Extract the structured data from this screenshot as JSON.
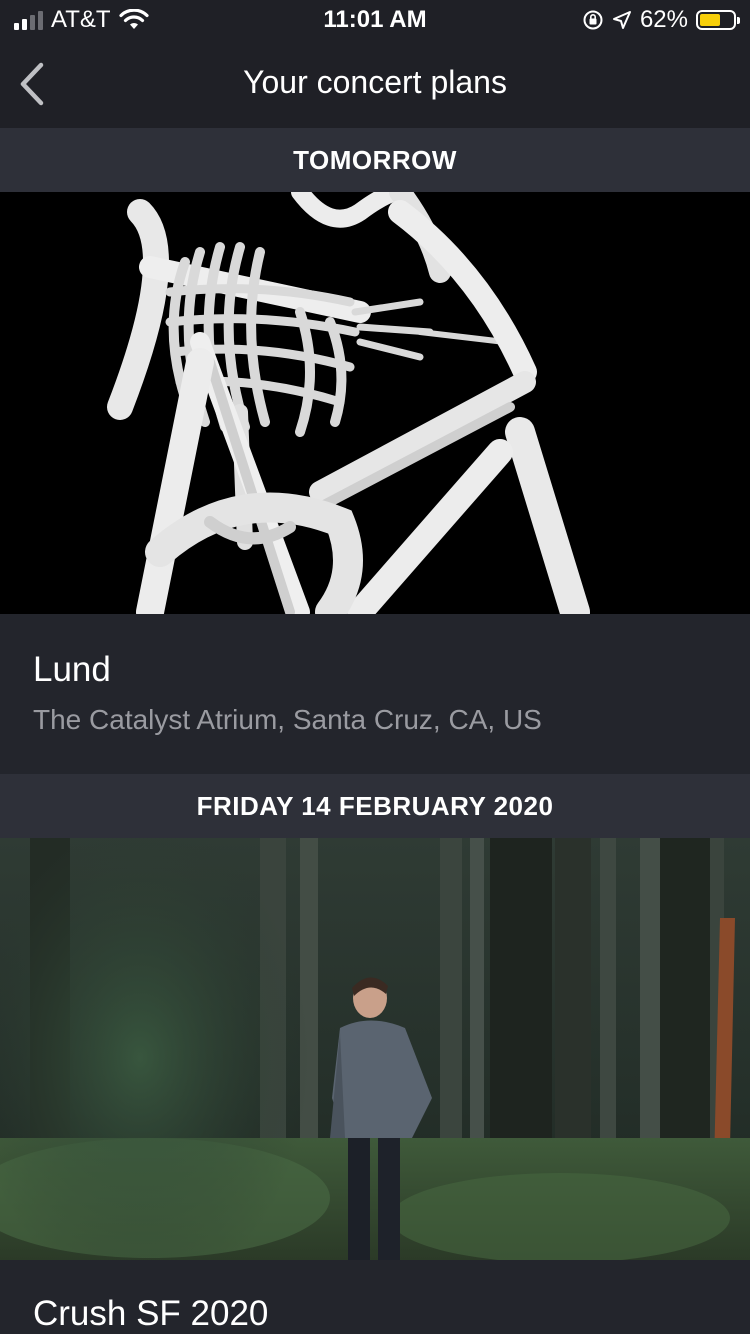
{
  "status_bar": {
    "carrier": "AT&T",
    "time": "11:01 AM",
    "battery_percent": "62%",
    "battery_level": 0.62,
    "battery_color": "#f7cf0a"
  },
  "nav": {
    "title": "Your concert plans",
    "back_icon": "chevron-left-icon"
  },
  "sections": [
    {
      "header": "TOMORROW",
      "event": {
        "title": "Lund",
        "venue": "The Catalyst Atrium, Santa Cruz, CA, US",
        "image": "skeleton-artwork"
      }
    },
    {
      "header": "FRIDAY 14 FEBRUARY 2020",
      "event": {
        "title": "Crush SF 2020",
        "venue": "",
        "image": "forest-photo"
      }
    }
  ],
  "colors": {
    "background": "#1f2026",
    "section_header": "#2e3039",
    "card": "#23252c",
    "secondary_text": "#9a9ba1"
  }
}
